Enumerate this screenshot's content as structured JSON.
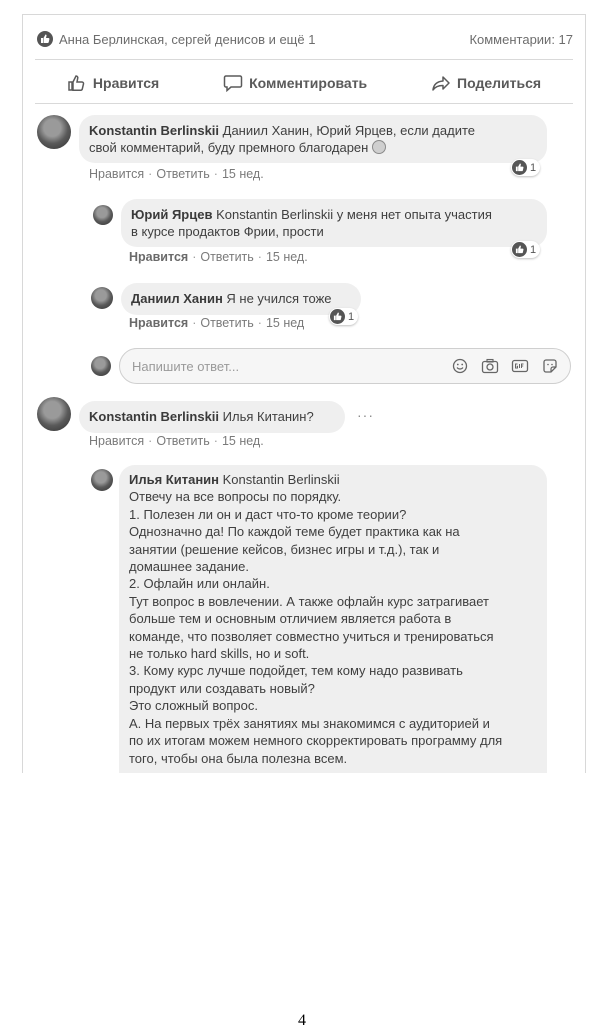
{
  "post": {
    "reactions_text": "Анна Берлинская, сергей денисов и ещё 1",
    "comments_count": "Комментарии: 17"
  },
  "actions": {
    "like": "Нравится",
    "comment": "Комментировать",
    "share": "Поделиться"
  },
  "comments": [
    {
      "author": "Konstantin Berlinskii",
      "text_line1": " Даниил Ханин, Юрий Ярцев, если дадите",
      "text_line2": "свой комментарий, буду премного благодарен",
      "emoji": "smiling-face",
      "like": "Нравится",
      "reply": "Ответить",
      "time": "15 нед.",
      "reaction_count": "1"
    },
    {
      "author": "Юрий Ярцев",
      "text_line1": " Konstantin Berlinskii у меня нет опыта участия",
      "text_line2": "в курсе продактов Фрии, прости",
      "like": "Нравится",
      "reply": "Ответить",
      "time": "15 нед.",
      "reaction_count": "1"
    },
    {
      "author": "Даниил Ханин",
      "text": " Я не учился тоже",
      "like": "Нравится",
      "reply": "Ответить",
      "time": "15 нед",
      "reaction_count": "1"
    },
    {
      "author": "Konstantin Berlinskii",
      "text": " Илья Китанин?",
      "like": "Нравится",
      "reply": "Ответить",
      "time": "15 нед."
    }
  ],
  "reply_input": {
    "placeholder": "Напишите ответ..."
  },
  "long_reply": {
    "author": "Илья Китанин",
    "mention": " Konstantin Berlinskii",
    "lines": [
      "Отвечу на все вопросы по порядку.",
      "1. Полезен ли он и даст что-то кроме теории?",
      "Однозначно да! По каждой теме будет практика как на",
      "занятии (решение кейсов, бизнес игры и т.д.), так и",
      "домашнее задание.",
      "2. Офлайн или онлайн.",
      "Тут вопрос в вовлечении. А также офлайн курс затрагивает",
      "больше тем и основным отличием является работа в",
      "команде, что позволяет совместно учиться и тренироваться",
      "не только hard skills, но и soft.",
      "3. Кому курс лучше подойдет, тем кому надо развивать",
      "продукт или создавать новый?",
      "Это сложный вопрос.",
      "А. На первых трёх занятиях мы знакомимся с аудиторией и",
      "по их итогам можем немного скорректировать программу для",
      "того, чтобы она была полезна всем."
    ]
  },
  "page_number": "4",
  "colors": {
    "text": "#3f3f3f",
    "bubble": "#efefef",
    "meta": "#7a7a7a"
  }
}
